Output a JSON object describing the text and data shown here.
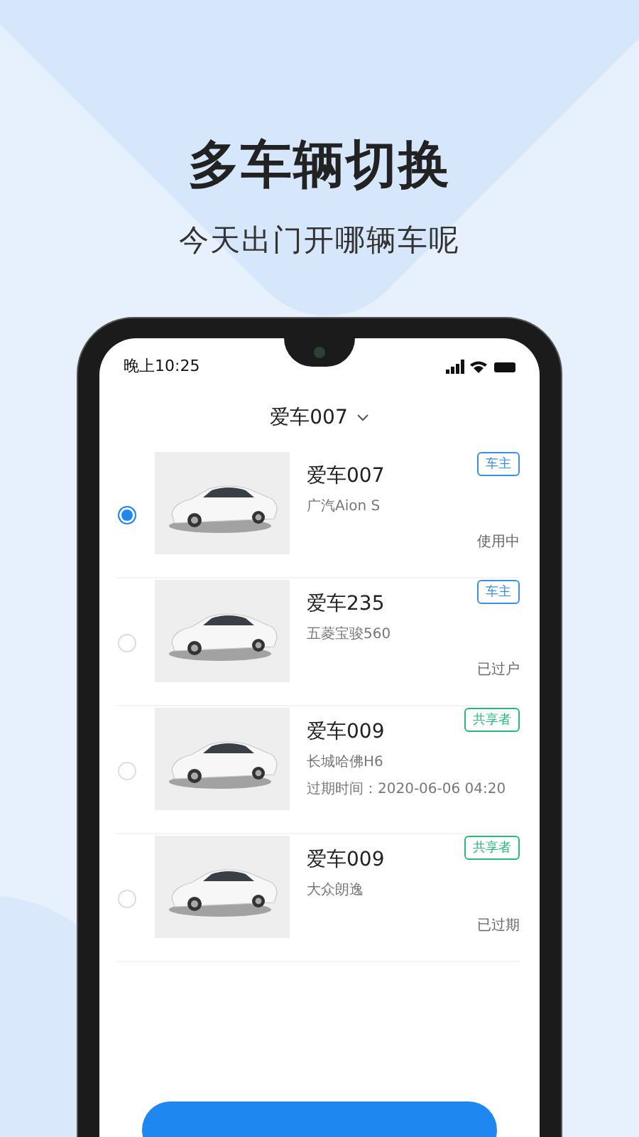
{
  "headline": "多车辆切换",
  "subtitle": "今天出门开哪辆车呢",
  "status_bar": {
    "time": "晚上10:25"
  },
  "header": {
    "title": "爱车007"
  },
  "cars": [
    {
      "name": "爱车007",
      "model": "广汽Aion S",
      "tag": {
        "label": "车主",
        "color": "#3a8ee6"
      },
      "status": "使用中",
      "selected": true
    },
    {
      "name": "爱车235",
      "model": "五菱宝骏560",
      "tag": {
        "label": "车主",
        "color": "#3a8ee6"
      },
      "status": "已过户",
      "selected": false
    },
    {
      "name": "爱车009",
      "model": "长城哈佛H6",
      "tag": {
        "label": "共享者",
        "color": "#2bb77a"
      },
      "detail": "过期时间：2020-06-06 04:20",
      "selected": false
    },
    {
      "name": "爱车009",
      "model": "大众朗逸",
      "tag": {
        "label": "共享者",
        "color": "#2bb77a"
      },
      "status": "已过期",
      "selected": false
    }
  ]
}
